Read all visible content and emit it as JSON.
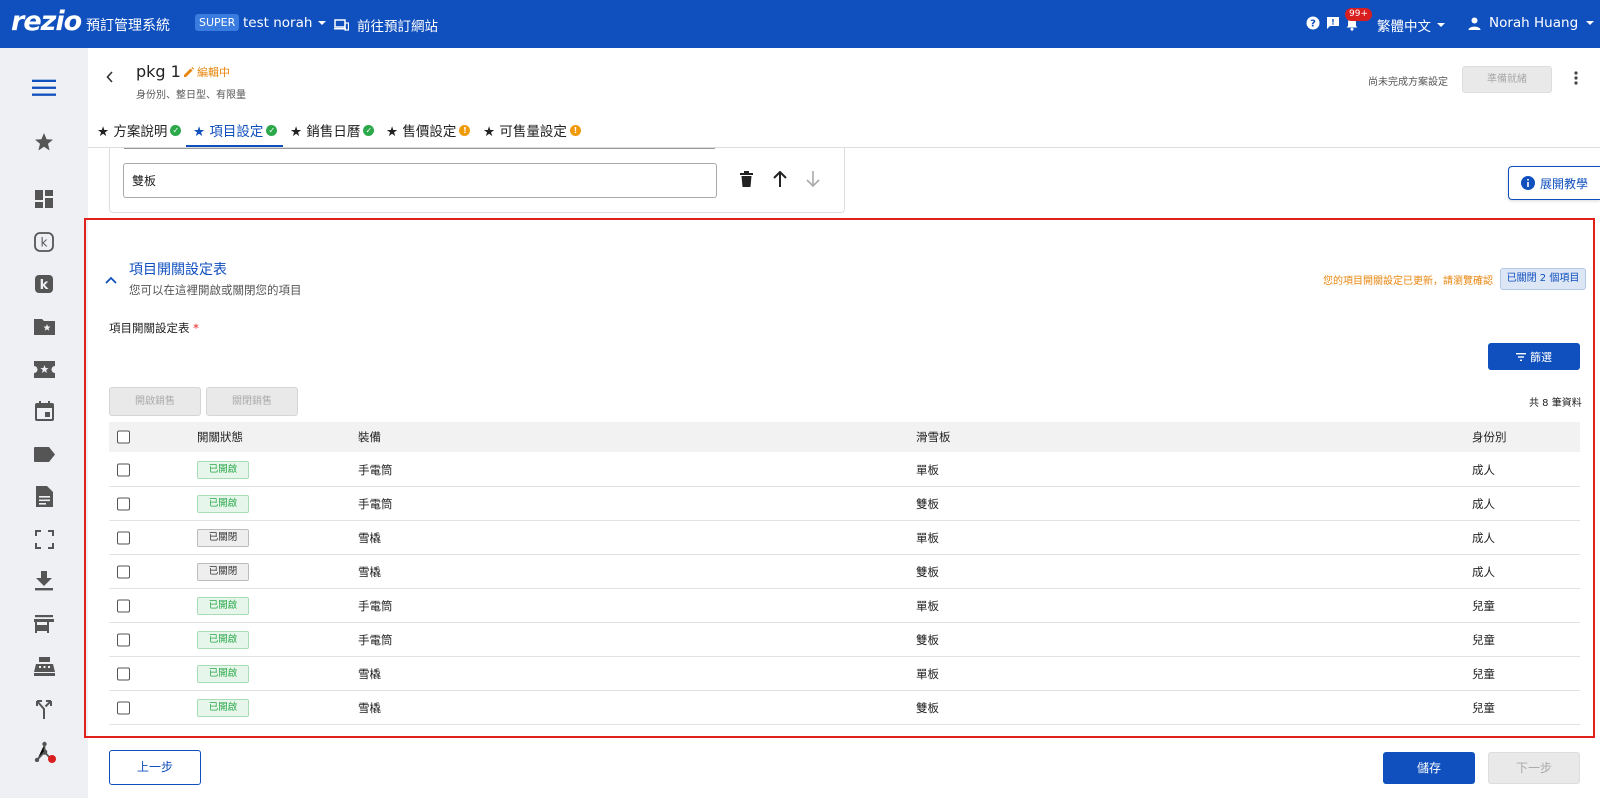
{
  "topbar": {
    "logo": "rezio",
    "system_title": "預訂管理系統",
    "super_badge": "SUPER",
    "user_switch": "test norah",
    "goto_site": "前往預訂網站",
    "notification_count": "99+",
    "language": "繁體中文",
    "account_name": "Norah Huang",
    "colors": {
      "bar": "#0f4fbe",
      "badge": "#d81e1e"
    }
  },
  "sidebar": {
    "items": [
      "menu-icon",
      "star-icon",
      "dashboard-icon",
      "k-outline-icon",
      "k-filled-icon",
      "folder-star-icon",
      "ticket-star-icon",
      "calendar-icon",
      "label-icon",
      "document-icon",
      "scan-icon",
      "download-icon",
      "store-icon",
      "cashier-icon",
      "merge-icon",
      "network-icon"
    ]
  },
  "header": {
    "title": "pkg 1",
    "edit_status": "編輯中",
    "subtitle": "身份別、整日型、有限量",
    "not_done_note": "尚未完成方案設定",
    "ready_button": "準備就緒"
  },
  "tabs": [
    {
      "label": "★ 方案說明",
      "status": "done"
    },
    {
      "label": "★ 項目設定",
      "status": "done",
      "active": true
    },
    {
      "label": "★ 銷售日曆",
      "status": "done"
    },
    {
      "label": "★ 售價設定",
      "status": "warning"
    },
    {
      "label": "★ 可售量設定",
      "status": "warning"
    }
  ],
  "upper_card": {
    "input_value": "雙板",
    "tutorial_button": "展開教學"
  },
  "section": {
    "title": "項目開關設定表",
    "description": "您可以在這裡開啟或關閉您的項目",
    "updated_note": "您的項目開關設定已更新，請瀏覽確認",
    "closed_count_badge": "已關閉 2 個項目",
    "field_label": "項目開關設定表",
    "required_mark": "*",
    "filter_button": "篩選",
    "open_sale_button": "開啟銷售",
    "close_sale_button": "關閉銷售",
    "total_count": "共 8 筆資料"
  },
  "table": {
    "headers": [
      "開關狀態",
      "裝備",
      "滑雪板",
      "身份別"
    ],
    "rows": [
      {
        "status": "已開啟",
        "on": true,
        "equipment": "手電筒",
        "board": "單板",
        "identity": "成人"
      },
      {
        "status": "已開啟",
        "on": true,
        "equipment": "手電筒",
        "board": "雙板",
        "identity": "成人"
      },
      {
        "status": "已關閉",
        "on": false,
        "equipment": "雪橇",
        "board": "單板",
        "identity": "成人"
      },
      {
        "status": "已關閉",
        "on": false,
        "equipment": "雪橇",
        "board": "雙板",
        "identity": "成人"
      },
      {
        "status": "已開啟",
        "on": true,
        "equipment": "手電筒",
        "board": "單板",
        "identity": "兒童"
      },
      {
        "status": "已開啟",
        "on": true,
        "equipment": "手電筒",
        "board": "雙板",
        "identity": "兒童"
      },
      {
        "status": "已開啟",
        "on": true,
        "equipment": "雪橇",
        "board": "單板",
        "identity": "兒童"
      },
      {
        "status": "已開啟",
        "on": true,
        "equipment": "雪橇",
        "board": "雙板",
        "identity": "兒童"
      }
    ]
  },
  "footer": {
    "prev_button": "上一步",
    "save_button": "儲存",
    "next_button": "下一步"
  }
}
